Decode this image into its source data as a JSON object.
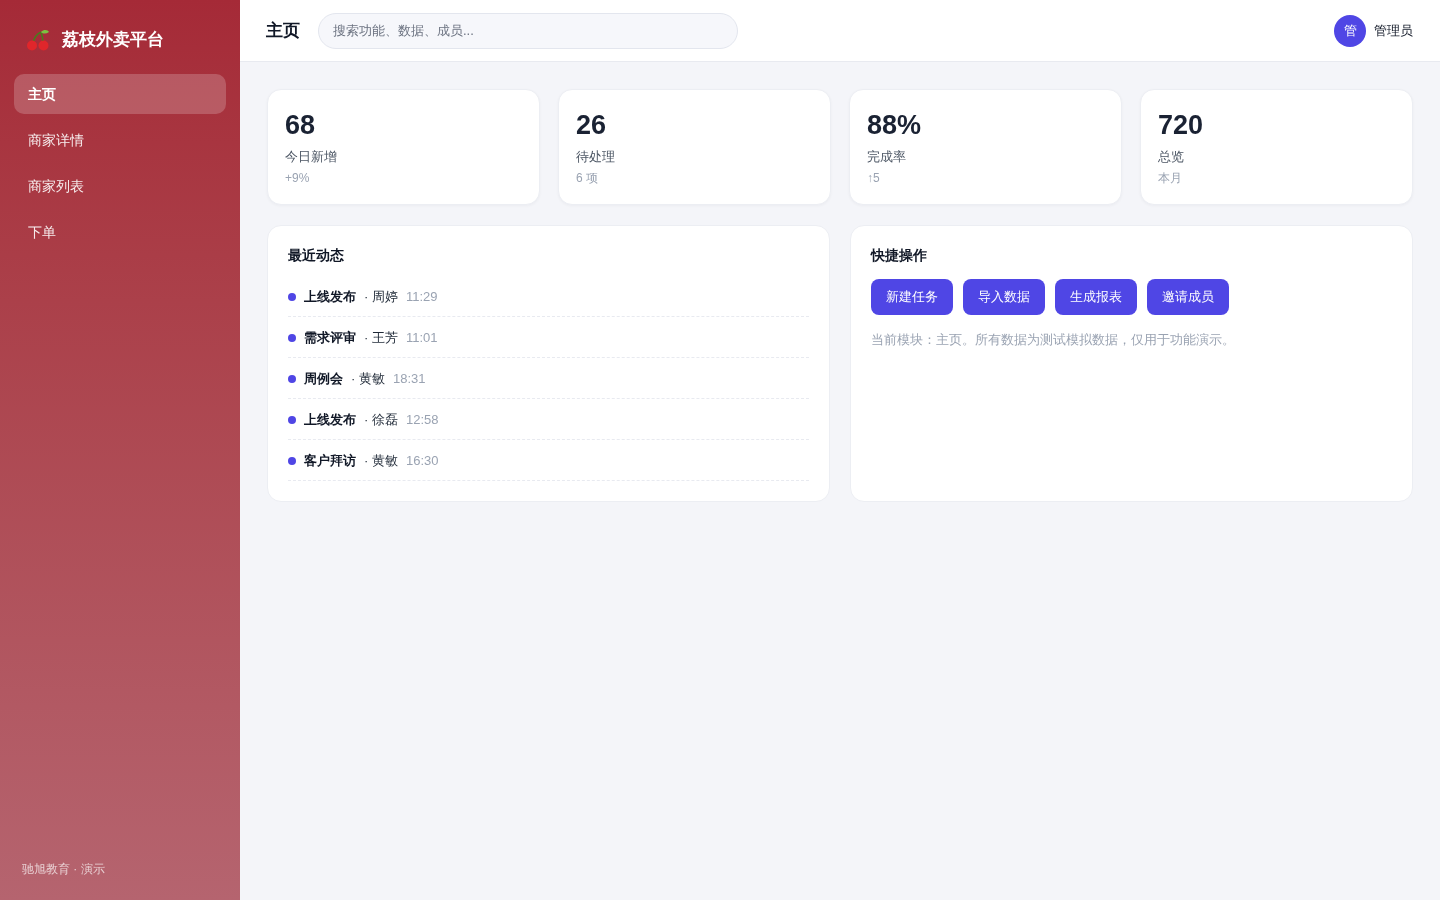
{
  "sidebar": {
    "brand": "荔枝外卖平台",
    "items": [
      {
        "label": "主页",
        "selected": true
      },
      {
        "label": "商家详情",
        "selected": false
      },
      {
        "label": "商家列表",
        "selected": false
      },
      {
        "label": "下单",
        "selected": false
      }
    ],
    "footer": "驰旭教育 · 演示"
  },
  "header": {
    "title": "主页",
    "search": {
      "placeholder": "搜索功能、数据、成员..."
    },
    "user": {
      "avatar": "管",
      "name": "管理员"
    }
  },
  "stats": [
    {
      "value": "68",
      "label": "今日新增",
      "note": "+9%"
    },
    {
      "value": "26",
      "label": "待处理",
      "note": "6 项"
    },
    {
      "value": "88%",
      "label": "完成率",
      "note": "↑5"
    },
    {
      "value": "720",
      "label": "总览",
      "note": "本月"
    }
  ],
  "recent_activity": {
    "title": "最近动态",
    "items": [
      {
        "title": "上线发布",
        "person": "· 周婷",
        "time": "11:29"
      },
      {
        "title": "需求评审",
        "person": "· 王芳",
        "time": "11:01"
      },
      {
        "title": "周例会",
        "person": "· 黄敏",
        "time": "18:31"
      },
      {
        "title": "上线发布",
        "person": "· 徐磊",
        "time": "12:58"
      },
      {
        "title": "客户拜访",
        "person": "· 黄敏",
        "time": "16:30"
      }
    ]
  },
  "quick_actions": {
    "title": "快捷操作",
    "buttons": [
      "新建任务",
      "导入数据",
      "生成报表",
      "邀请成员"
    ],
    "note": "当前模块：主页。所有数据为测试模拟数据，仅用于功能演示。"
  }
}
